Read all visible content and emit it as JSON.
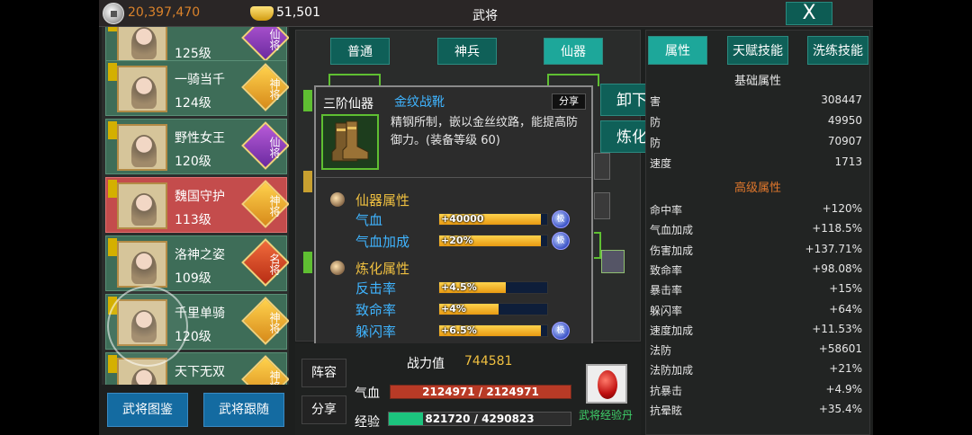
{
  "topbar": {
    "silver": "20,397,470",
    "gold": "51,501",
    "title": "武将",
    "close_label": "X"
  },
  "heroes": [
    {
      "name": "",
      "level": "125级",
      "rank": "仙将",
      "rank_color": "purple",
      "selected": false
    },
    {
      "name": "一骑当千",
      "level": "124级",
      "rank": "神将",
      "rank_color": "gold",
      "selected": false
    },
    {
      "name": "野性女王",
      "level": "120级",
      "rank": "仙将",
      "rank_color": "purple",
      "selected": false
    },
    {
      "name": "魏国守护",
      "level": "113级",
      "rank": "神将",
      "rank_color": "gold",
      "selected": true
    },
    {
      "name": "洛神之姿",
      "level": "109级",
      "rank": "名将",
      "rank_color": "red",
      "selected": false
    },
    {
      "name": "千里单骑",
      "level": "120级",
      "rank": "神将",
      "rank_color": "gold",
      "selected": false
    },
    {
      "name": "天下无双",
      "level": "",
      "rank": "神将",
      "rank_color": "gold",
      "selected": false
    }
  ],
  "left_buttons": {
    "codex": "武将图鉴",
    "follow": "武将跟随"
  },
  "mid_tabs": [
    "普通",
    "神兵",
    "仙器"
  ],
  "item": {
    "tier": "三阶仙器",
    "name": "金纹战靴",
    "share": "分享",
    "desc": "精钢所制，嵌以金丝纹路，能提高防御力。(装备等级 60)",
    "section1": "仙器属性",
    "attrs1": [
      {
        "label": "气血",
        "value": "+40000",
        "fill": 0.94,
        "gem": "极"
      },
      {
        "label": "气血加成",
        "value": "+20%",
        "fill": 0.94,
        "gem": "极"
      }
    ],
    "section2": "炼化属性",
    "attrs2": [
      {
        "label": "反击率",
        "value": "+4.5%",
        "fill": 0.62,
        "gem": ""
      },
      {
        "label": "致命率",
        "value": "+4%",
        "fill": 0.55,
        "gem": ""
      },
      {
        "label": "躲闪率",
        "value": "+6.5%",
        "fill": 0.94,
        "gem": "极"
      }
    ]
  },
  "actions": {
    "unequip": "卸下",
    "refine": "炼化"
  },
  "bottom": {
    "power_label": "战力值",
    "power_value": "744581",
    "lineup": "阵容",
    "share": "分享",
    "hp_label": "气血",
    "hp_value": "2124971 / 2124971",
    "exp_label": "经验",
    "exp_value": "821720 / 4290823",
    "exp_fraction": 0.19,
    "pill_label": "武将经验丹"
  },
  "right_tabs": [
    "属性",
    "天赋技能",
    "洗练技能"
  ],
  "base_title": "基础属性",
  "base_stats": [
    {
      "label": "害",
      "value": "308447"
    },
    {
      "label": "防",
      "value": "49950"
    },
    {
      "label": "防",
      "value": "70907"
    },
    {
      "label": "速度",
      "value": "1713"
    }
  ],
  "adv_title": "高级属性",
  "adv_stats": [
    {
      "label": "命中率",
      "value": "+120%"
    },
    {
      "label": "气血加成",
      "value": "+118.5%"
    },
    {
      "label": "伤害加成",
      "value": "+137.71%"
    },
    {
      "label": "致命率",
      "value": "+98.08%"
    },
    {
      "label": "暴击率",
      "value": "+15%"
    },
    {
      "label": "躲闪率",
      "value": "+64%"
    },
    {
      "label": "速度加成",
      "value": "+11.53%"
    },
    {
      "label": "法防",
      "value": "+58601"
    },
    {
      "label": "法防加成",
      "value": "+21%"
    },
    {
      "label": "抗暴击",
      "value": "+4.9%"
    },
    {
      "label": "抗晕眩",
      "value": "+35.4%"
    }
  ],
  "colors": {
    "accent": "#1da79a",
    "gold_text": "#f0c040",
    "section_orange": "#e0772c",
    "attr_blue": "#3fb4ff"
  }
}
